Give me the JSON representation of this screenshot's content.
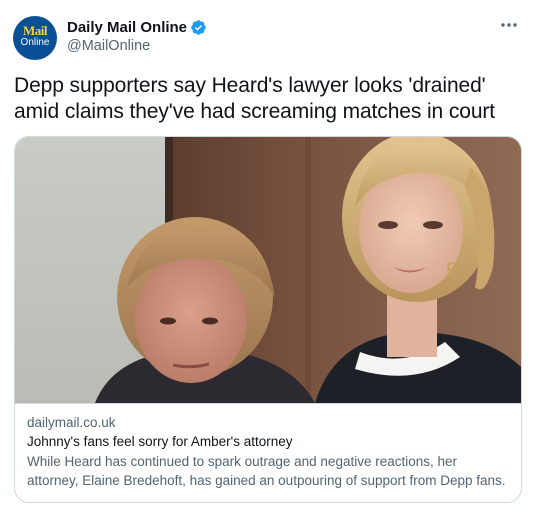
{
  "account": {
    "avatar_logo_top": "Mail",
    "avatar_logo_bottom": "Online",
    "display_name": "Daily Mail Online",
    "handle": "@MailOnline",
    "verified": true
  },
  "tweet": {
    "text": "Depp supporters say Heard's lawyer looks 'drained' amid claims they've had screaming matches in court"
  },
  "card": {
    "domain": "dailymail.co.uk",
    "title": "Johnny's fans feel sorry for Amber's attorney",
    "description": "While Heard has continued to spark outrage and negative reactions, her attorney, Elaine Bredehoft, has gained an outpouring of support from Depp fans."
  },
  "colors": {
    "verified_blue": "#1d9bf0",
    "secondary_text": "#536471",
    "primary_text": "#0f1419",
    "border": "#cfd9de",
    "avatar_bg": "#0a4f98",
    "avatar_logo_yellow": "#f4d03f"
  },
  "icons": {
    "verified": "verified-badge-icon",
    "more": "more-options-icon"
  }
}
